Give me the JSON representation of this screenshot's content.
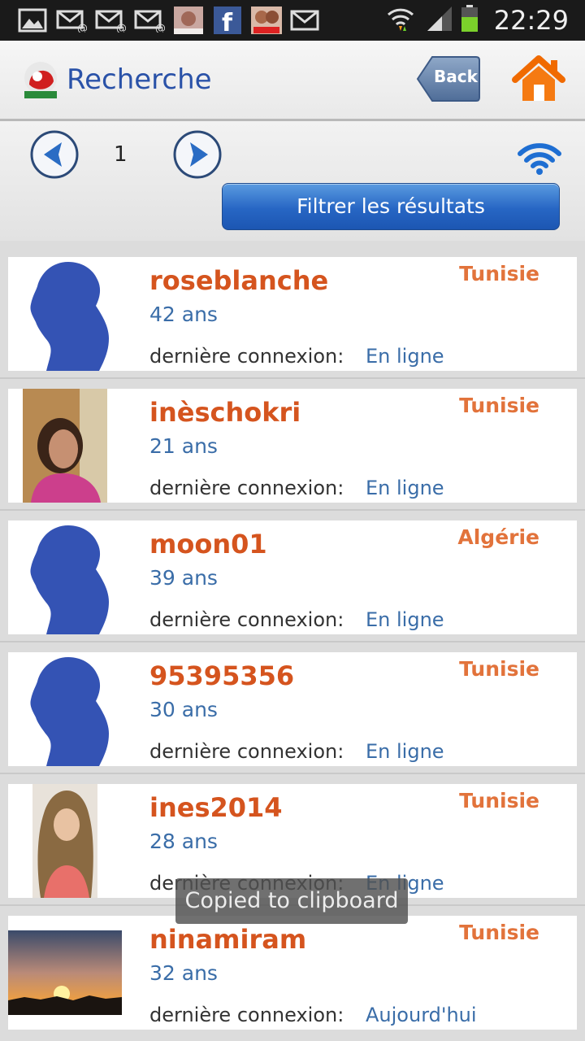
{
  "status_bar": {
    "time": "22:29",
    "icons": [
      "gallery-icon",
      "email-icon",
      "email-icon",
      "email-icon",
      "app-icon",
      "facebook-icon",
      "chat-icon",
      "mail-icon"
    ],
    "right_icons": [
      "wifi-icon",
      "signal-icon",
      "battery-icon"
    ]
  },
  "header": {
    "title": "Recherche",
    "back_label": "Back"
  },
  "pager": {
    "page": "1",
    "filter_label": "Filtrer les résultats"
  },
  "last_label": "dernière connexion:",
  "profiles": [
    {
      "username": "roseblanche",
      "age": "42 ans",
      "last_seen": "En ligne",
      "country": "Tunisie",
      "avatar": "silhouette"
    },
    {
      "username": "inèschokri",
      "age": "21 ans",
      "last_seen": "En ligne",
      "country": "Tunisie",
      "avatar": "photo-pink"
    },
    {
      "username": "moon01",
      "age": "39 ans",
      "last_seen": "En ligne",
      "country": "Algérie",
      "avatar": "silhouette"
    },
    {
      "username": "95395356",
      "age": "30 ans",
      "last_seen": "En ligne",
      "country": "Tunisie",
      "avatar": "silhouette"
    },
    {
      "username": "ines2014",
      "age": "28 ans",
      "last_seen": "En ligne",
      "country": "Tunisie",
      "avatar": "photo-hair"
    },
    {
      "username": "ninamiram",
      "age": "32 ans",
      "last_seen": "Aujourd'hui",
      "country": "Tunisie",
      "avatar": "photo-sunset"
    }
  ],
  "toast": "Copied to clipboard",
  "colors": {
    "username": "#d5541e",
    "country": "#e2733b",
    "accent_blue": "#3a6da8",
    "filter_button": "#2766c4"
  }
}
